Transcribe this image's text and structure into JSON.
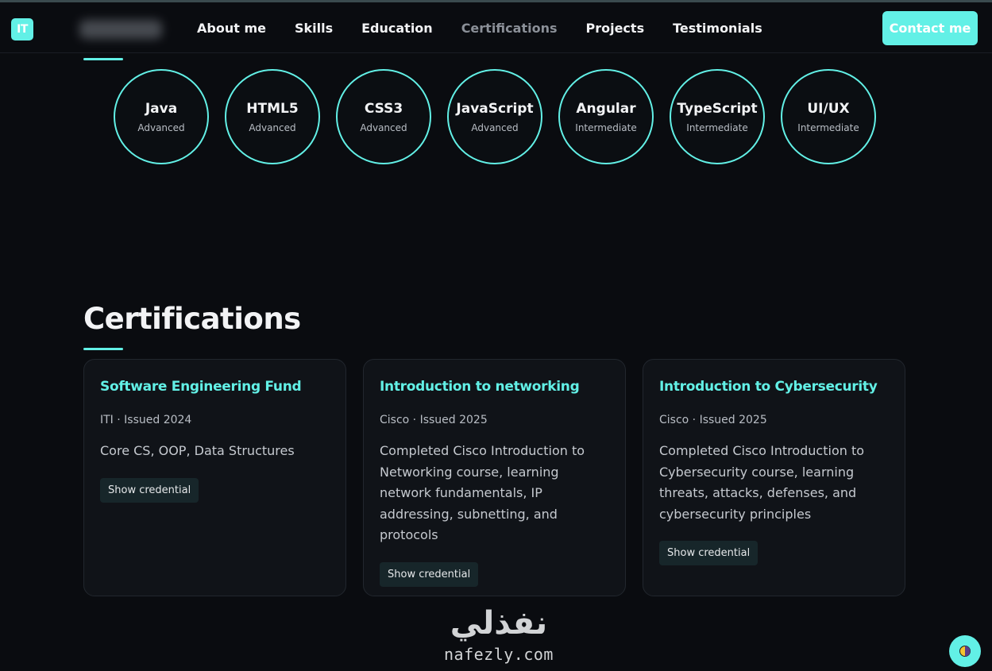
{
  "navbar": {
    "logo_text": "IT",
    "links": [
      "About me",
      "Skills",
      "Education",
      "Certifications",
      "Projects",
      "Testimonials"
    ],
    "active_link": "Certifications",
    "contact_label": "Contact me"
  },
  "skills": [
    {
      "name": "Java",
      "level": "Advanced"
    },
    {
      "name": "HTML5",
      "level": "Advanced"
    },
    {
      "name": "CSS3",
      "level": "Advanced"
    },
    {
      "name": "JavaScript",
      "level": "Advanced"
    },
    {
      "name": "Angular",
      "level": "Intermediate"
    },
    {
      "name": "TypeScript",
      "level": "Intermediate"
    },
    {
      "name": "UI/UX",
      "level": "Intermediate"
    }
  ],
  "certifications": {
    "title": "Certifications",
    "cards": [
      {
        "title": "Software Engineering Fund",
        "meta": "ITI · Issued 2024",
        "description": "Core CS, OOP, Data Structures",
        "button": "Show credential"
      },
      {
        "title": "Introduction to networking",
        "meta": "Cisco · Issued 2025",
        "description": "Completed Cisco Introduction to Networking course, learning network fundamentals, IP addressing, subnetting, and protocols",
        "button": "Show credential"
      },
      {
        "title": "Introduction to Cybersecurity",
        "meta": "Cisco · Issued 2025",
        "description": "Completed Cisco Introduction to Cybersecurity course, learning threats, attacks, defenses, and cybersecurity principles",
        "button": "Show credential"
      }
    ]
  },
  "watermark": {
    "arabic": "نفذلي",
    "latin": "nafezly.com"
  },
  "colors": {
    "accent": "#62f0e6",
    "background": "#0a0c10",
    "card": "#101318"
  }
}
